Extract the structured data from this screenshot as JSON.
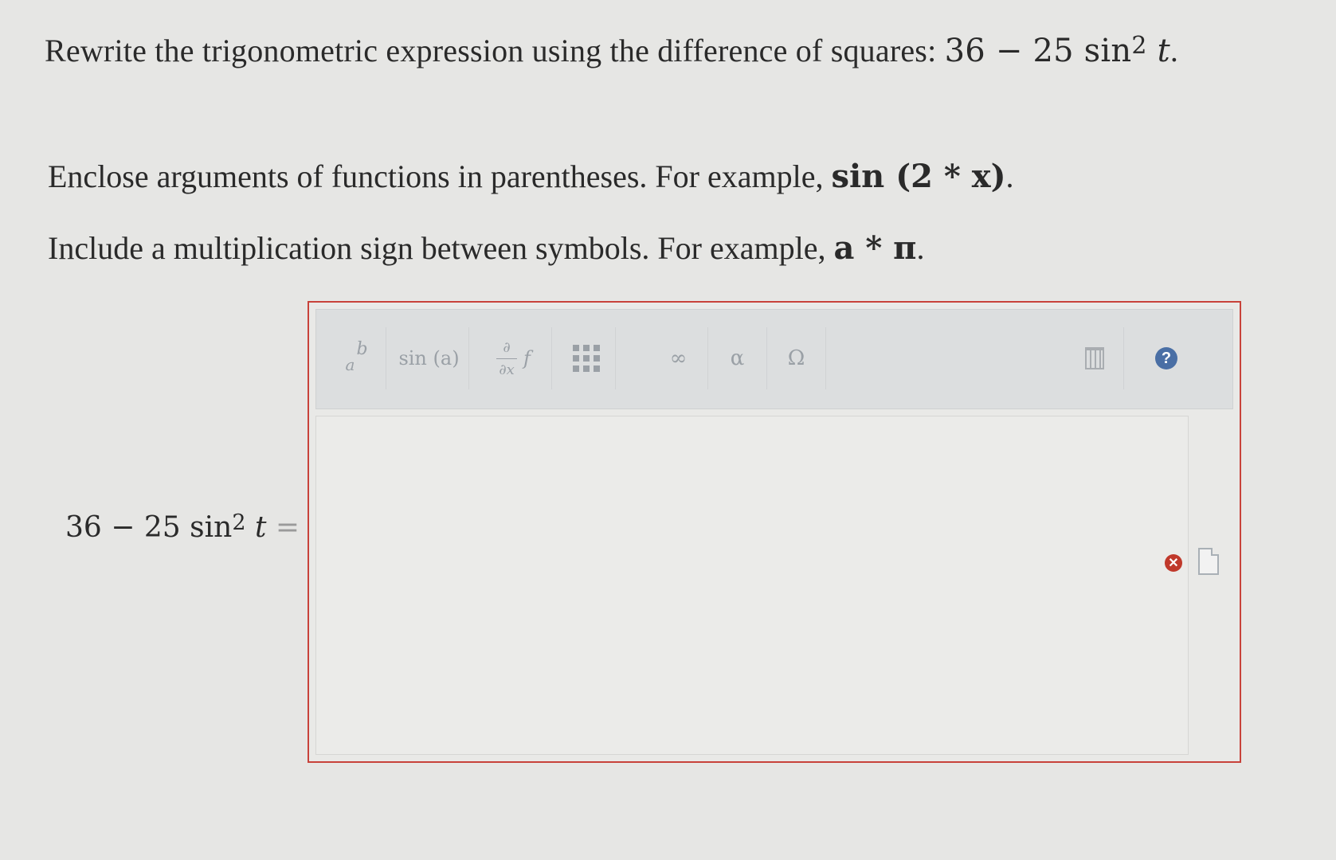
{
  "question": {
    "prefix": "Rewrite the trigonometric expression using the difference of squares: ",
    "expr_a": "36",
    "minus": " − ",
    "expr_b": "25 sin",
    "exp": "2",
    "var": "t",
    "suffix": "."
  },
  "instructions": {
    "line1_text": "Enclose arguments of functions in parentheses. For example, ",
    "line1_example": "sin (2 * x)",
    "line1_end": ".",
    "line2_text": "Include a multiplication sign between symbols. For example, ",
    "line2_example": "a * π",
    "line2_end": "."
  },
  "equation": {
    "lhs_a": "36",
    "minus": " − ",
    "lhs_b": "25 sin",
    "exp": "2",
    "var": "t",
    "equals": " ="
  },
  "toolbar": {
    "power_base": "a",
    "power_exp": "b",
    "sin_label": "sin (a)",
    "deriv_num": "∂",
    "deriv_den": "∂x",
    "deriv_f": "f",
    "infinity": "∞",
    "alpha": "α",
    "omega": "Ω",
    "help": "?"
  },
  "answer": {
    "value": ""
  },
  "status": {
    "error_symbol": "✕"
  },
  "colors": {
    "error_border": "#c8423a",
    "help_blue": "#4a6fa5",
    "error_red": "#c0392b"
  }
}
